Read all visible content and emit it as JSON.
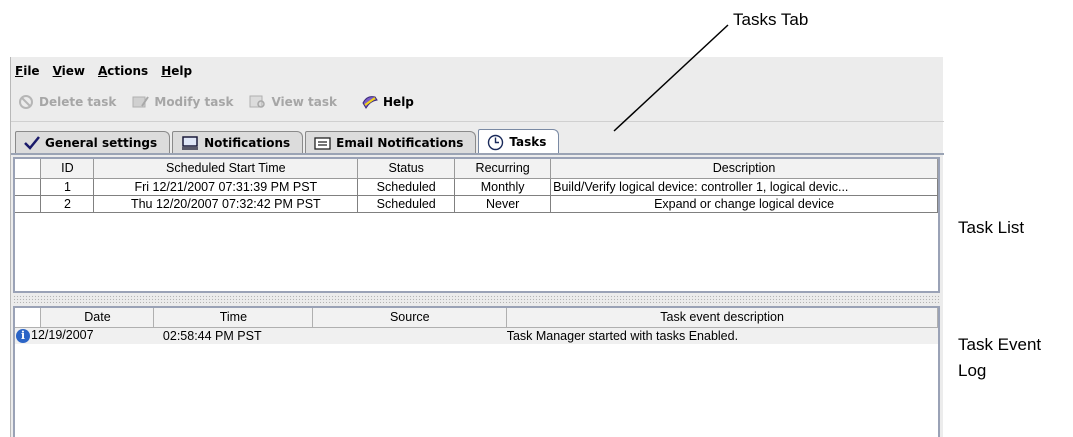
{
  "callouts": {
    "tasks_tab": "Tasks Tab",
    "task_list": "Task List",
    "task_event_log_1": "Task Event",
    "task_event_log_2": "Log"
  },
  "menu": {
    "file": {
      "mnemonic": "F",
      "rest": "ile"
    },
    "view": {
      "mnemonic": "V",
      "rest": "iew"
    },
    "actions": {
      "mnemonic": "A",
      "rest": "ctions"
    },
    "help": {
      "mnemonic": "H",
      "rest": "elp"
    }
  },
  "toolbar": {
    "delete_task": "Delete task",
    "modify_task": "Modify task",
    "view_task": "View task",
    "help": "Help"
  },
  "tabs": [
    {
      "label": "General settings",
      "icon": "checkmark-icon"
    },
    {
      "label": "Notifications",
      "icon": "monitor-icon"
    },
    {
      "label": "Email Notifications",
      "icon": "envelope-icon"
    },
    {
      "label": "Tasks",
      "icon": "clock-icon",
      "active": true
    }
  ],
  "task_list": {
    "columns": [
      "ID",
      "Scheduled Start Time",
      "Status",
      "Recurring",
      "Description"
    ],
    "rows": [
      {
        "id": "1",
        "start": "Fri 12/21/2007 07:31:39 PM PST",
        "status": "Scheduled",
        "recurring": "Monthly",
        "description": "Build/Verify logical device: controller 1, logical devic..."
      },
      {
        "id": "2",
        "start": "Thu 12/20/2007 07:32:42 PM PST",
        "status": "Scheduled",
        "recurring": "Never",
        "description": "Expand or change logical device"
      }
    ]
  },
  "event_log": {
    "columns": [
      "Date",
      "Time",
      "Source",
      "Task event description"
    ],
    "rows": [
      {
        "icon": "info-icon",
        "date": "12/19/2007",
        "time": "02:58:44 PM PST",
        "source": "",
        "description": "Task Manager started with tasks Enabled."
      }
    ]
  },
  "colors": {
    "accent": "#2b64c6",
    "disabled_text": "#a6a6a6",
    "panel_border": "#9aa2b6"
  }
}
